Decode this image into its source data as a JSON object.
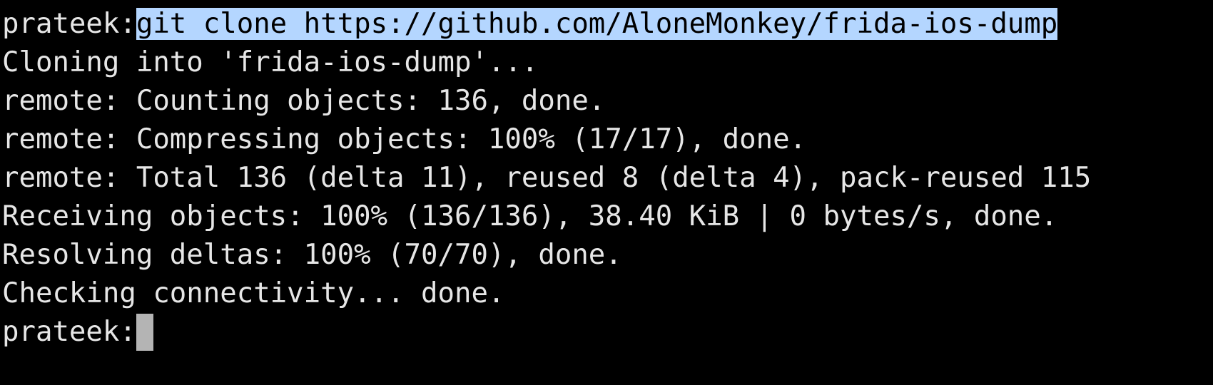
{
  "terminal": {
    "command": {
      "prompt": "prateek:",
      "text": "git clone https://github.com/AloneMonkey/frida-ios-dump"
    },
    "output": [
      "Cloning into 'frida-ios-dump'...",
      "remote: Counting objects: 136, done.",
      "remote: Compressing objects: 100% (17/17), done.",
      "remote: Total 136 (delta 11), reused 8 (delta 4), pack-reused 115",
      "Receiving objects: 100% (136/136), 38.40 KiB | 0 bytes/s, done.",
      "Resolving deltas: 100% (70/70), done.",
      "Checking connectivity... done."
    ],
    "current_prompt": "prateek:"
  },
  "colors": {
    "background": "#000000",
    "text": "#e6e6e6",
    "selection": "#b4d6ff",
    "cursor": "#b4b4b4"
  }
}
